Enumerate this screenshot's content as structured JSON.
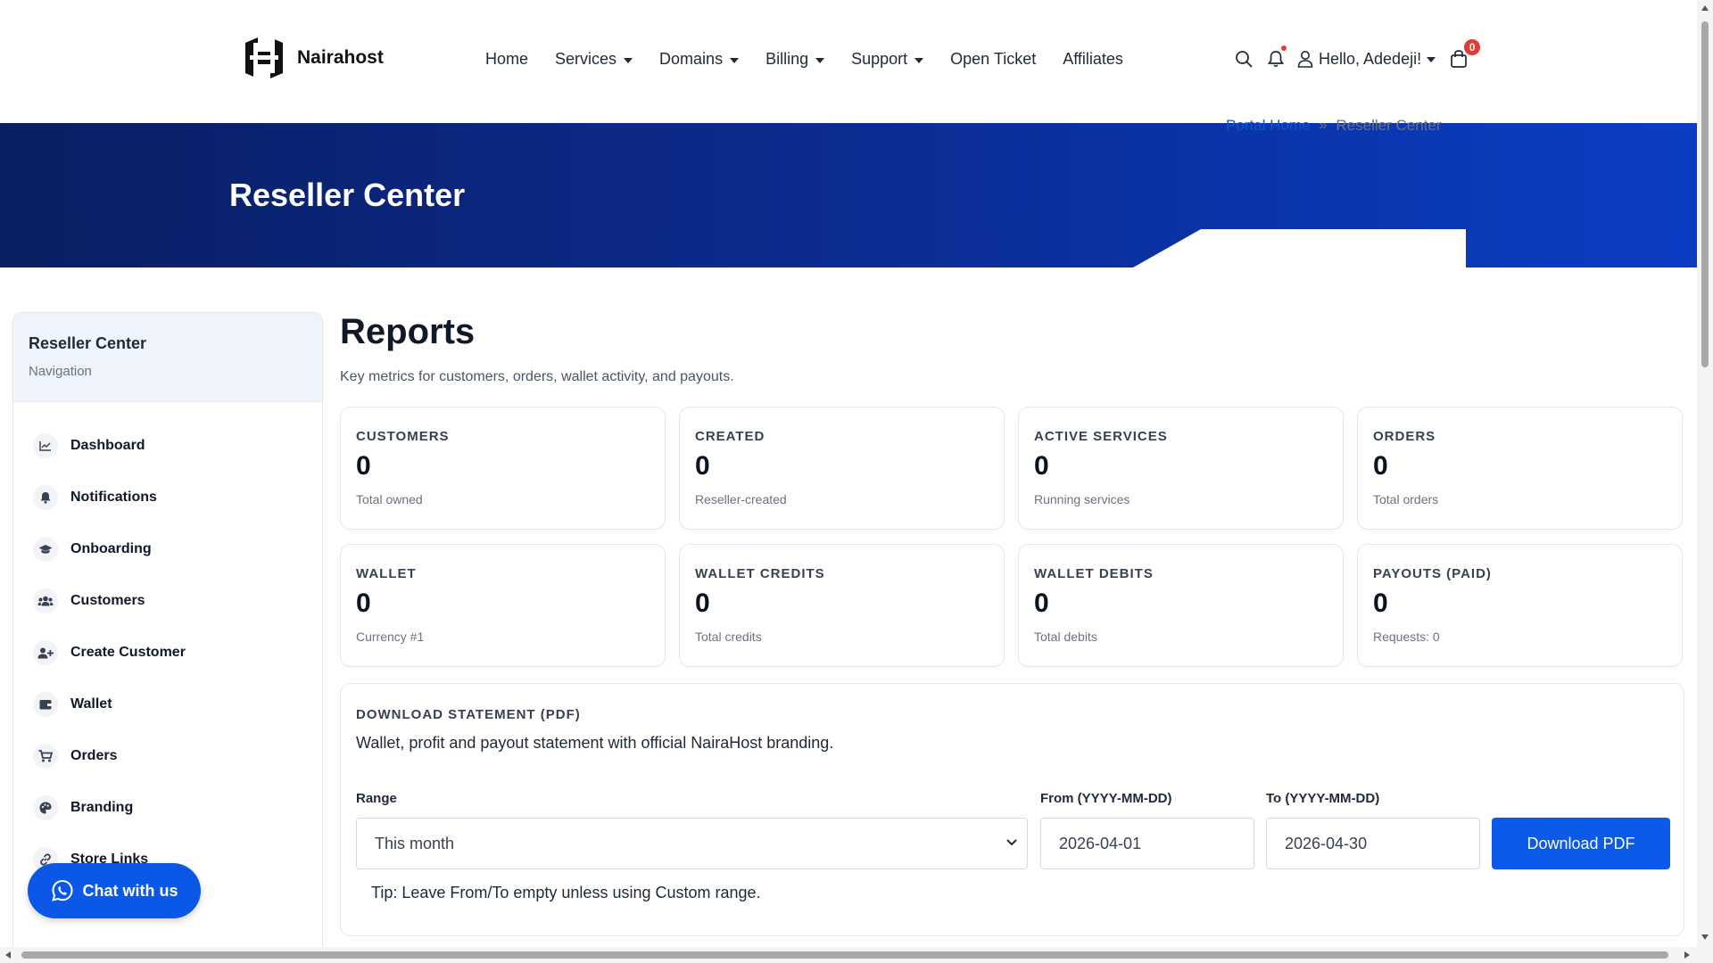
{
  "brand": {
    "name": "Nairahost"
  },
  "nav": {
    "items": [
      {
        "label": "Home",
        "dropdown": false
      },
      {
        "label": "Services",
        "dropdown": true
      },
      {
        "label": "Domains",
        "dropdown": true
      },
      {
        "label": "Billing",
        "dropdown": true
      },
      {
        "label": "Support",
        "dropdown": true
      },
      {
        "label": "Open Ticket",
        "dropdown": false
      },
      {
        "label": "Affiliates",
        "dropdown": false
      }
    ],
    "user_greeting": "Hello, Adedeji!",
    "cart_count": "0"
  },
  "hero": {
    "title": "Reseller Center",
    "breadcrumb": {
      "home": "Portal Home",
      "current": "Reseller Center"
    }
  },
  "sidebar": {
    "title": "Reseller Center",
    "subtitle": "Navigation",
    "items": [
      {
        "label": "Dashboard",
        "icon": "chart-line-icon"
      },
      {
        "label": "Notifications",
        "icon": "bell-icon"
      },
      {
        "label": "Onboarding",
        "icon": "graduation-cap-icon"
      },
      {
        "label": "Customers",
        "icon": "users-icon"
      },
      {
        "label": "Create Customer",
        "icon": "user-plus-icon"
      },
      {
        "label": "Wallet",
        "icon": "wallet-icon"
      },
      {
        "label": "Orders",
        "icon": "cart-icon"
      },
      {
        "label": "Branding",
        "icon": "palette-icon"
      },
      {
        "label": "Store Links",
        "icon": "link-icon"
      }
    ]
  },
  "chat": {
    "label": "Chat with us"
  },
  "main": {
    "title": "Reports",
    "subtitle": "Key metrics for customers, orders, wallet activity, and payouts.",
    "cards": [
      {
        "label": "CUSTOMERS",
        "value": "0",
        "note": "Total owned"
      },
      {
        "label": "CREATED",
        "value": "0",
        "note": "Reseller-created"
      },
      {
        "label": "ACTIVE SERVICES",
        "value": "0",
        "note": "Running services"
      },
      {
        "label": "ORDERS",
        "value": "0",
        "note": "Total orders"
      },
      {
        "label": "WALLET",
        "value": "0",
        "note": "Currency #1"
      },
      {
        "label": "WALLET CREDITS",
        "value": "0",
        "note": "Total credits"
      },
      {
        "label": "WALLET DEBITS",
        "value": "0",
        "note": "Total debits"
      },
      {
        "label": "PAYOUTS (PAID)",
        "value": "0",
        "note": "Requests: 0"
      }
    ],
    "statement": {
      "label": "DOWNLOAD STATEMENT (PDF)",
      "description": "Wallet, profit and payout statement with official NairaHost branding.",
      "range_label": "Range",
      "range_value": "This month",
      "from_label": "From (YYYY-MM-DD)",
      "from_value": "2026-04-01",
      "to_label": "To (YYYY-MM-DD)",
      "to_value": "2026-04-30",
      "button": "Download PDF",
      "tip": "Tip: Leave From/To empty unless using Custom range."
    }
  },
  "colors": {
    "hero_start": "#0a1f63",
    "hero_end": "#0b3dc4",
    "primary_button": "#0b5ae8",
    "link": "#0b57d0",
    "badge": "#e53935"
  }
}
